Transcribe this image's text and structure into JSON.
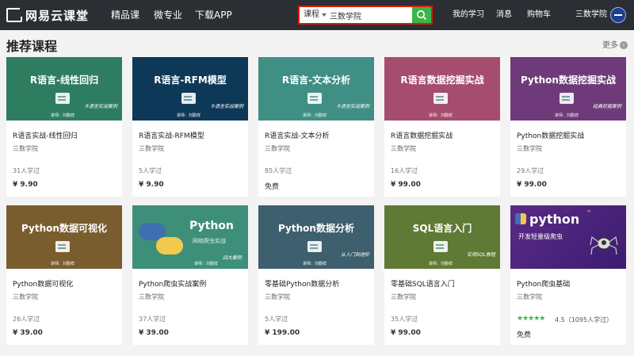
{
  "header": {
    "logo_text": "网易云课堂",
    "nav": [
      "精品课",
      "微专业",
      "下载APP"
    ],
    "search": {
      "category": "课程",
      "value": "三数学院"
    },
    "right_nav": [
      "我的学习",
      "消息",
      "购物车",
      "三数学院"
    ]
  },
  "section": {
    "title": "推荐课程",
    "more_label": "更多"
  },
  "courses": [
    {
      "cover_title": "R语言-线性回归",
      "cover_sub": "R语言实战案例",
      "lecturer": "讲师：刘勤祥",
      "cover_color": "#2f7d61",
      "name": "R语言实战-线性回归",
      "org": "三数学院",
      "learners": "31人学过",
      "price": "¥ 9.90"
    },
    {
      "cover_title": "R语言-RFM模型",
      "cover_sub": "R语言实战案例",
      "lecturer": "讲师：刘勤祥",
      "cover_color": "#0e3858",
      "name": "R语言实战-RFM模型",
      "org": "三数学院",
      "learners": "5人学过",
      "price": "¥ 9.90"
    },
    {
      "cover_title": "R语言-文本分析",
      "cover_sub": "R语言实战案例",
      "lecturer": "讲师：刘勤祥",
      "cover_color": "#3f8f84",
      "name": "R语言实战-文本分析",
      "org": "三数学院",
      "learners": "85人学过",
      "price": "免费"
    },
    {
      "cover_title": "R语言数据挖掘实战",
      "cover_sub": "",
      "lecturer": "讲师：刘勤祥",
      "cover_color": "#a64c6e",
      "name": "R语言数据挖掘实战",
      "org": "三数学院",
      "learners": "16人学过",
      "price": "¥ 99.00"
    },
    {
      "cover_title": "Python数据挖掘实战",
      "cover_sub": "经典挖掘案例",
      "lecturer": "讲师：刘勤祥",
      "cover_color": "#6f3a7a",
      "name": "Python数据挖掘实战",
      "org": "三数学院",
      "learners": "29人学过",
      "price": "¥ 99.00"
    },
    {
      "cover_title": "Python数据可视化",
      "cover_sub": "",
      "lecturer": "讲师：刘勤祥",
      "cover_color": "#7a5d2e",
      "name": "Python数据可视化",
      "org": "三数学院",
      "learners": "26人学过",
      "price": "¥ 39.00"
    },
    {
      "cover_title": "Python",
      "cover_sub": "网络爬虫实战",
      "lecturer": "讲师：刘勤祥",
      "cover_tag": "四大案例",
      "cover_color": "#3d8f7a",
      "name": "Python爬虫实战案例",
      "org": "三数学院",
      "learners": "37人学过",
      "price": "¥ 39.00"
    },
    {
      "cover_title": "Python数据分析",
      "cover_sub": "从入门到进阶",
      "lecturer": "讲师：刘勤祥",
      "cover_color": "#3d5f6e",
      "name": "零基础Python数据分析",
      "org": "三数学院",
      "learners": "5人学过",
      "price": "¥ 199.00"
    },
    {
      "cover_title": "SQL语言入门",
      "cover_sub": "实用SQL教程",
      "lecturer": "讲师：刘勤祥",
      "cover_color": "#5f7a34",
      "name": "零基础SQL语言入门",
      "org": "三数学院",
      "learners": "35人学过",
      "price": "¥ 99.00"
    },
    {
      "cover_title": "python",
      "cover_tm": "™",
      "cover_sub": "开发轻量级爬虫",
      "cover_color": "#4b2478",
      "name": "Python爬虫基础",
      "org": "三数学院",
      "stars": "★★★★★",
      "rating": "4.5（1095人学过）",
      "price": "免费"
    }
  ]
}
